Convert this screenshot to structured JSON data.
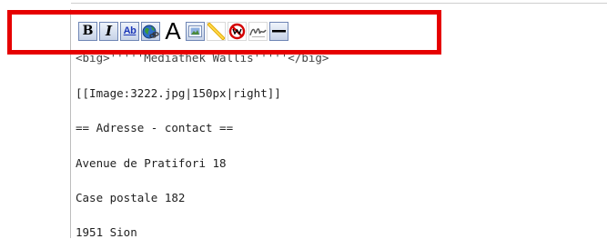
{
  "toolbar": {
    "buttons": [
      {
        "name": "bold-button",
        "icon": "bold-icon",
        "label": "B"
      },
      {
        "name": "italic-button",
        "icon": "italic-icon",
        "label": "I"
      },
      {
        "name": "internal-link-button",
        "icon": "ab-link-icon",
        "label": "Ab"
      },
      {
        "name": "external-link-button",
        "icon": "globe-link-icon",
        "label": ""
      },
      {
        "name": "headline-button",
        "icon": "headline-A-icon",
        "label": "A"
      },
      {
        "name": "embedded-image-button",
        "icon": "image-icon",
        "label": ""
      },
      {
        "name": "media-file-button",
        "icon": "media-icon",
        "label": ""
      },
      {
        "name": "nowiki-button",
        "icon": "no-wiki-icon",
        "label": ""
      },
      {
        "name": "signature-button",
        "icon": "signature-icon",
        "label": ""
      },
      {
        "name": "horizontal-line-button",
        "icon": "horizontal-line-icon",
        "label": ""
      }
    ]
  },
  "editor": {
    "lines": [
      "<big>'''''Mediathek Wallis'''''</big>",
      "[[Image:3222.jpg|150px|right]]",
      "== Adresse - contact ==",
      "Avenue de Pratifori 18",
      "Case postale 182",
      "1951 Sion"
    ]
  },
  "colors": {
    "annotation": "#e60000",
    "toolbar_border": "#6f86b5"
  }
}
